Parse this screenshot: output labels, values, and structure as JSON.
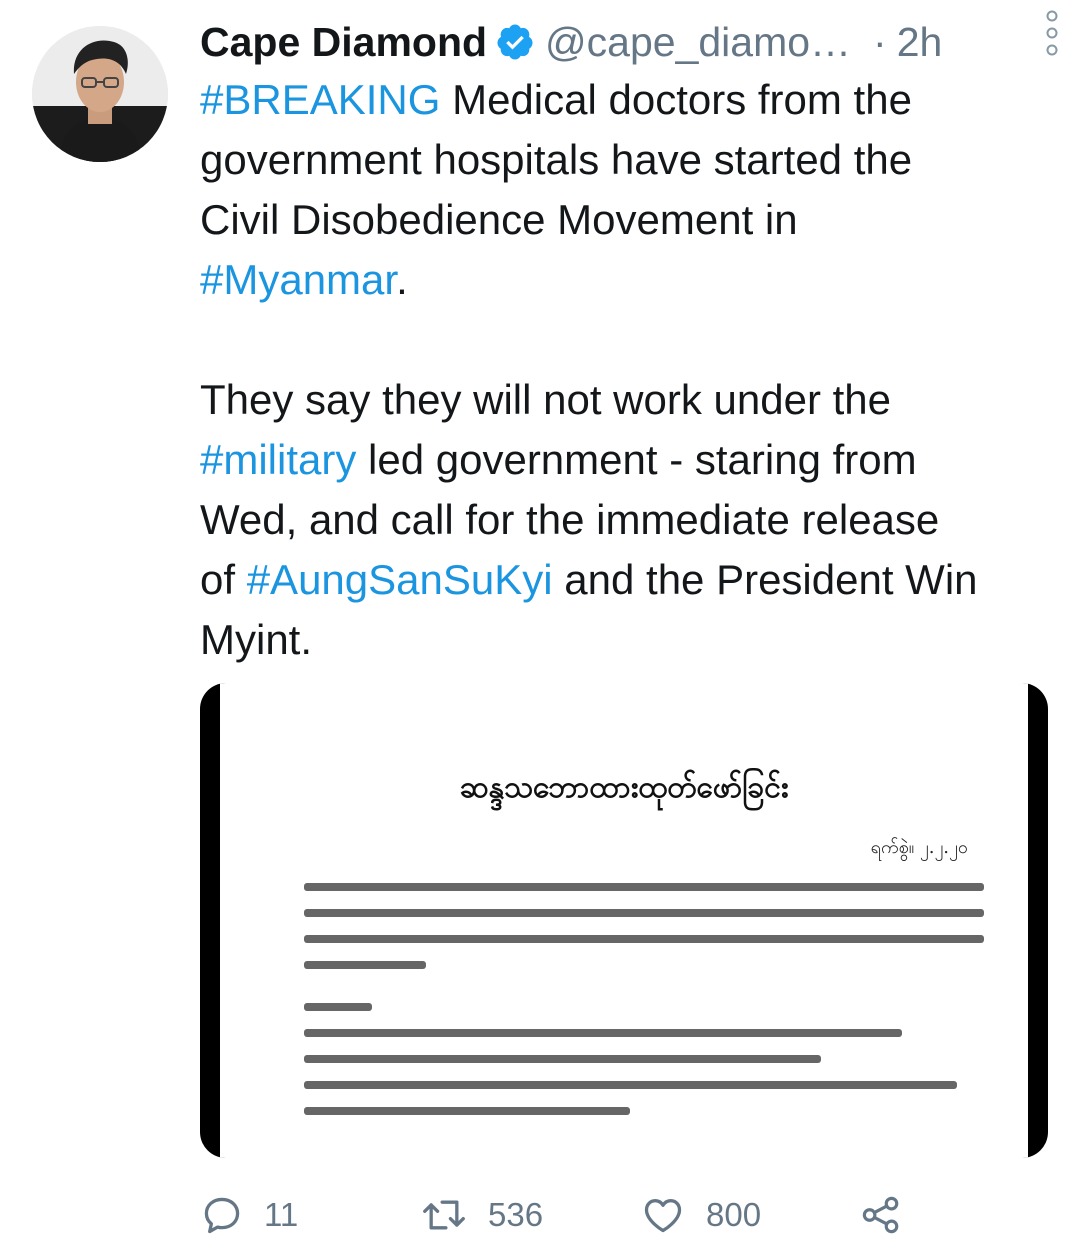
{
  "tweet": {
    "author_name": "Cape Diamond",
    "handle": "@cape_diamo…",
    "time_separator": "·",
    "time": "2h",
    "text_parts": [
      {
        "text": "#BREAKING",
        "type": "hashtag"
      },
      {
        "text": " Medical doctors from the\ngovernment hospitals have started the\nCivil Disobedience Movement in\n",
        "type": "text"
      },
      {
        "text": "#Myanmar",
        "type": "hashtag"
      },
      {
        "text": ".\n\nThey say they will not work under the\n",
        "type": "text"
      },
      {
        "text": "#military",
        "type": "hashtag"
      },
      {
        "text": " led government - staring from\nWed, and call for the immediate release\nof ",
        "type": "text"
      },
      {
        "text": "#AungSanSuKyi",
        "type": "hashtag"
      },
      {
        "text": " and the President Win\nMyint.",
        "type": "text"
      }
    ],
    "media": {
      "title": "ဆန္ဒသဘောထားထုတ်ဖော်ခြင်း",
      "date_line": "ရက်စွဲ။ ၂.၂.၂၀"
    },
    "actions": {
      "replies": "11",
      "retweets": "536",
      "likes": "800"
    }
  },
  "colors": {
    "link": "#1b95e0",
    "verified": "#1da1f2",
    "muted": "#657786"
  },
  "icons": [
    "verified-badge-icon",
    "more-vertical-icon",
    "reply-icon",
    "retweet-icon",
    "like-icon",
    "share-icon"
  ]
}
